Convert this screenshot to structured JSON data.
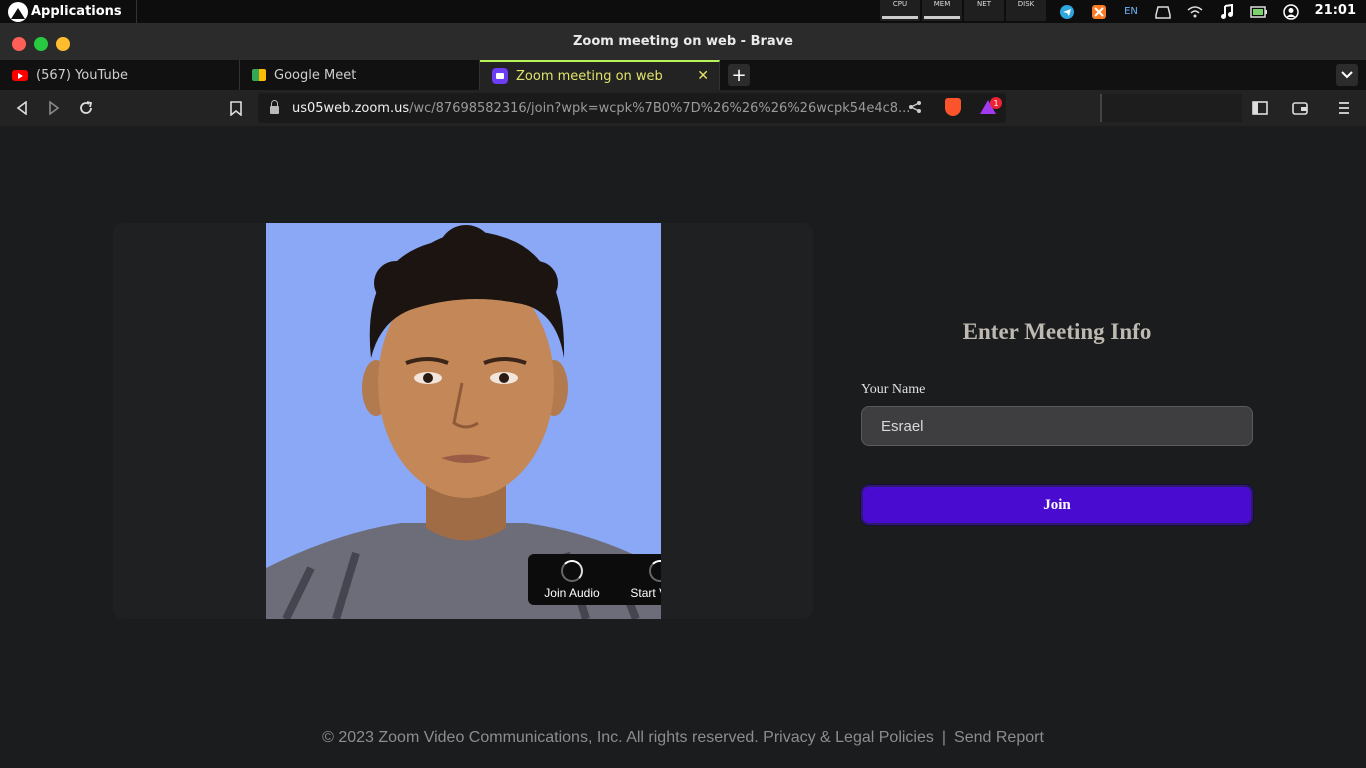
{
  "system_panel": {
    "apps_label": "Applications",
    "monitors": [
      "CPU",
      "MEM",
      "NET",
      "DISK"
    ],
    "lang": "EN",
    "clock": "21:01"
  },
  "window": {
    "title": "Zoom meeting on web - Brave"
  },
  "tabs": [
    {
      "label": "(567) YouTube",
      "icon": "youtube-icon"
    },
    {
      "label": "Google Meet",
      "icon": "google-meet-icon"
    },
    {
      "label": "Zoom meeting on web",
      "icon": "zoom-icon",
      "active": true
    }
  ],
  "address_bar": {
    "host": "us05web.zoom.us",
    "path": "/wc/87698582316/join?wpk=wcpk%7B0%7D%26%26%26%26wcpk54e4c8...",
    "rewards_badge": "1"
  },
  "preview": {
    "join_audio_label": "Join Audio",
    "start_video_label": "Start Video"
  },
  "form": {
    "title": "Enter Meeting Info",
    "name_label": "Your Name",
    "name_value": "Esrael",
    "join_label": "Join"
  },
  "footer": {
    "copyright": "© 2023 Zoom Video Communications, Inc. All rights reserved.",
    "privacy_link": "Privacy & Legal Policies",
    "separator": "|",
    "report_link": "Send Report"
  },
  "colors": {
    "join_button": "#4a0bd1",
    "active_tab_accent": "#b9f35a",
    "video_background": "#8aa8f6"
  }
}
